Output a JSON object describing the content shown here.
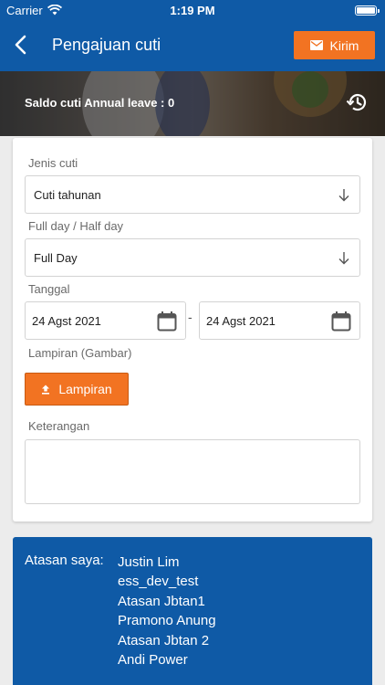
{
  "status_bar": {
    "carrier": "Carrier",
    "time": "1:19 PM"
  },
  "header": {
    "title": "Pengajuan cuti",
    "submit_label": "Kirim"
  },
  "banner": {
    "saldo_text": "Saldo cuti Annual leave : 0"
  },
  "form": {
    "jenis_cuti_label": "Jenis cuti",
    "jenis_cuti_value": "Cuti tahunan",
    "day_type_label": "Full day / Half day",
    "day_type_value": "Full Day",
    "tanggal_label": "Tanggal",
    "start_date": "24 Agst 2021",
    "date_separator": "-",
    "end_date": "24 Agst 2021",
    "lampiran_label": "Lampiran (Gambar)",
    "lampiran_button": "Lampiran",
    "keterangan_label": "Keterangan",
    "keterangan_value": ""
  },
  "atasan": {
    "label": "Atasan saya:",
    "names": [
      "Justin Lim",
      "ess_dev_test",
      "Atasan Jbtan1",
      "Pramono Anung",
      "Atasan Jbtan 2",
      "Andi Power"
    ]
  },
  "icons": {
    "back": "back-arrow-icon",
    "mail": "mail-icon",
    "history": "history-icon",
    "dropdown": "arrow-down-icon",
    "calendar": "calendar-icon",
    "upload": "upload-icon"
  },
  "colors": {
    "primary": "#0f5aa6",
    "accent": "#f27322"
  }
}
